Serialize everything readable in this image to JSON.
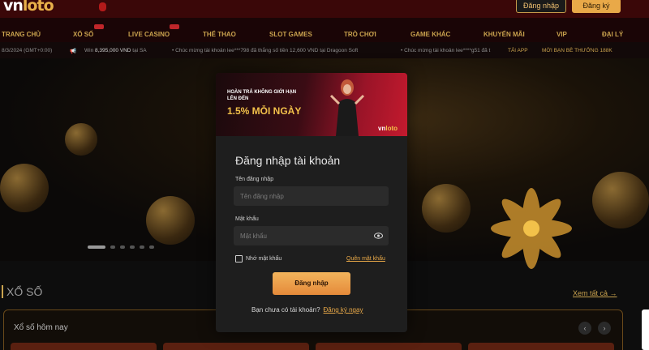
{
  "header": {
    "logo_main": "vn",
    "logo_accent": "loto",
    "login_label": "Đăng nhập",
    "register_label": "Đăng ký"
  },
  "nav": {
    "items": [
      "TRANG CHỦ",
      "XỔ SỐ",
      "LIVE CASINO",
      "THỂ THAO",
      "SLOT GAMES",
      "TRÒ CHƠI",
      "GAME KHÁC",
      "KHUYẾN MÃI",
      "VIP",
      "ĐẠI LÝ"
    ]
  },
  "ticker": {
    "date": "8/3/2024 (GMT+0:00)",
    "msg1_prefix": "Win",
    "msg1_amount": "8,395,000 VND",
    "msg1_suffix": "tại SA",
    "msg2": "• Chúc mừng tài khoản lee***798 đã thắng số tiền 12,600 VND tại Dragoon Soft",
    "msg3": "• Chúc mừng tài khoản lee****g51 đã t",
    "app_label": "TẢI APP",
    "referral_label": "MỜI BẠN BÈ THƯỞNG 188K"
  },
  "section": {
    "title": "XỔ SỐ",
    "view_all": "Xem tất cả",
    "panel_title": "Xổ số hôm nay"
  },
  "promo": {
    "line1": "HOÀN TRẢ KHÔNG GIỚI HẠN LÊN ĐẾN",
    "big": "1.5% MỖI NGÀY",
    "logo_main": "vn",
    "logo_accent": "loto"
  },
  "login_form": {
    "title": "Đăng nhập tài khoản",
    "username_label": "Tên đăng nhập",
    "username_placeholder": "Tên đăng nhập",
    "password_label": "Mật khẩu",
    "password_placeholder": "Mật khẩu",
    "remember_label": "Nhớ mật khẩu",
    "forgot_label": "Quên mật khẩu",
    "submit_label": "Đăng nhập",
    "no_account": "Bạn chưa có tài khoản?",
    "register_link": "Đăng ký ngay"
  },
  "icons": {
    "password_toggle": "eye-icon",
    "slider_prev": "chevron-left-icon",
    "slider_next": "chevron-right-icon",
    "view_all_arrow": "arrow-right-icon"
  },
  "colors": {
    "accent_gold": "#e9a948",
    "header_red": "#3a0708",
    "promo_red": "#c41a2e"
  }
}
